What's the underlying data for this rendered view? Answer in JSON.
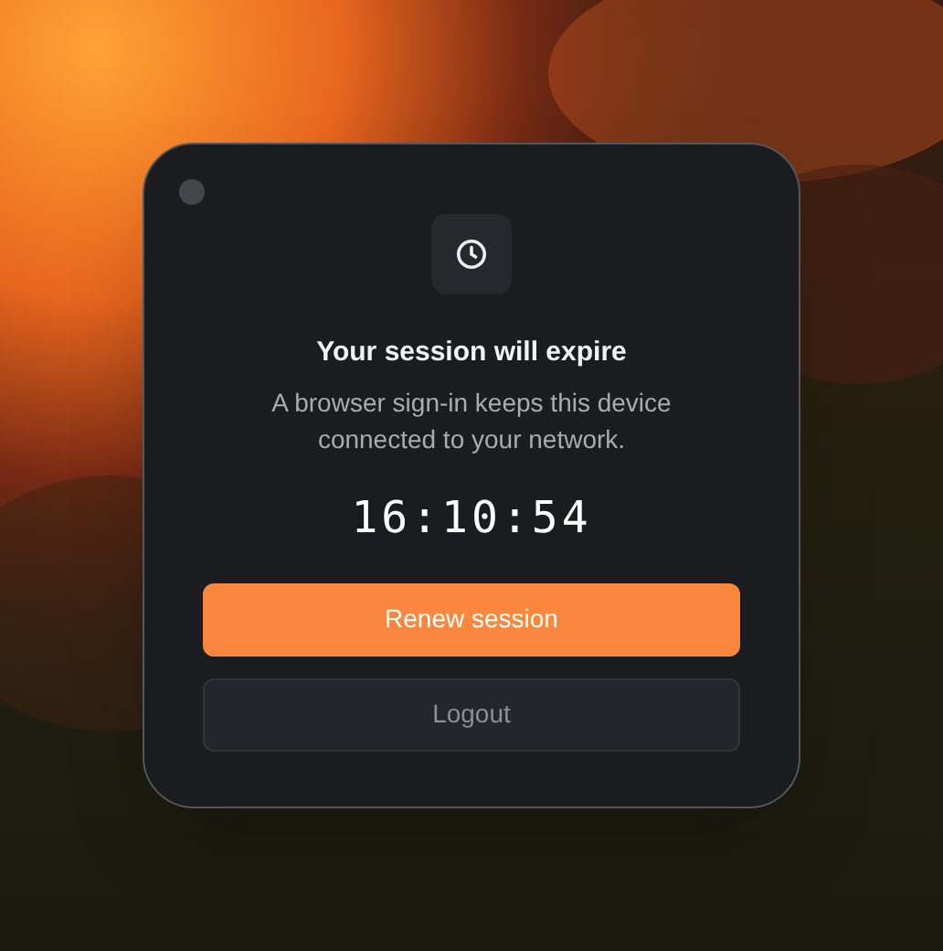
{
  "dialog": {
    "title": "Your session will expire",
    "message": "A browser sign-in keeps this device connected to your network.",
    "countdown": "16:10:54",
    "buttons": [
      {
        "label": "Renew session",
        "kind": "primary"
      },
      {
        "label": "Logout",
        "kind": "secondary"
      }
    ]
  }
}
